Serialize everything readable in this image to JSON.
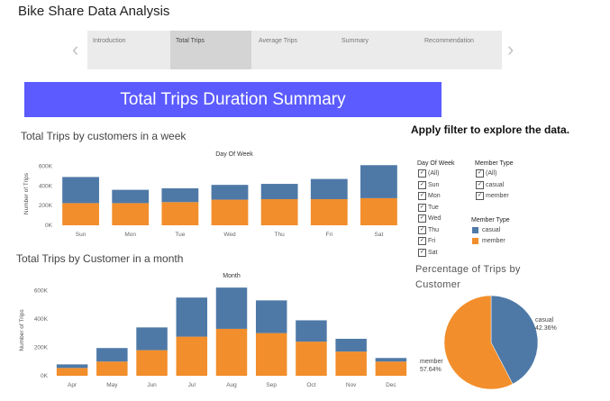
{
  "app": {
    "title": "Bike Share Data Analysis"
  },
  "nav": {
    "tabs": [
      {
        "label": "Introduction",
        "active": false
      },
      {
        "label": "Total Trips",
        "active": true
      },
      {
        "label": "Average Trips",
        "active": false
      },
      {
        "label": "Summary",
        "active": false
      },
      {
        "label": "Recommendation",
        "active": false
      }
    ],
    "prev_icon": "chevron-left-icon",
    "next_icon": "chevron-right-icon"
  },
  "banner": {
    "title": "Total Trips Duration Summary",
    "bg_color": "#5b5bff"
  },
  "colors": {
    "casual": "#4e79a7",
    "member": "#f28e2b"
  },
  "filters": {
    "heading": "Apply filter to explore the data.",
    "day_of_week": {
      "label": "Day Of Week",
      "options": [
        {
          "label": "(All)",
          "checked": true
        },
        {
          "label": "Sun",
          "checked": true
        },
        {
          "label": "Mon",
          "checked": true
        },
        {
          "label": "Tue",
          "checked": true
        },
        {
          "label": "Wed",
          "checked": true
        },
        {
          "label": "Thu",
          "checked": true
        },
        {
          "label": "Fri",
          "checked": true
        },
        {
          "label": "Sat",
          "checked": true
        }
      ]
    },
    "member_type": {
      "label": "Member Type",
      "options": [
        {
          "label": "(All)",
          "checked": true
        },
        {
          "label": "casual",
          "checked": true
        },
        {
          "label": "member",
          "checked": true
        }
      ]
    },
    "legend": {
      "label": "Member Type",
      "items": [
        {
          "label": "casual",
          "color": "#4e79a7"
        },
        {
          "label": "member",
          "color": "#f28e2b"
        }
      ]
    }
  },
  "pie": {
    "title": "Percentage of Trips by Customer",
    "casual_label": "casual",
    "casual_pct": "42.36%",
    "member_label": "member",
    "member_pct": "57.64%"
  },
  "chart_data": [
    {
      "type": "bar",
      "stacked": true,
      "title": "Total Trips by customers in a week",
      "header": "Day Of Week",
      "xlabel": "",
      "ylabel": "Number of Trips",
      "categories": [
        "Sun",
        "Mon",
        "Tue",
        "Wed",
        "Thu",
        "Fri",
        "Sat"
      ],
      "yticks": [
        0,
        200000,
        400000,
        600000
      ],
      "ytick_labels": [
        "0K",
        "200K",
        "400K",
        "600K"
      ],
      "ylim": [
        0,
        640000
      ],
      "series": [
        {
          "name": "member",
          "values": [
            225000,
            225000,
            235000,
            260000,
            265000,
            265000,
            275000
          ]
        },
        {
          "name": "casual",
          "values": [
            265000,
            135000,
            140000,
            150000,
            155000,
            205000,
            335000
          ]
        }
      ],
      "grid": false
    },
    {
      "type": "bar",
      "stacked": true,
      "title": "Total Trips by Customer in a month",
      "header": "Month",
      "xlabel": "",
      "ylabel": "Number of Trips",
      "categories": [
        "Apr",
        "May",
        "Jun",
        "Jul",
        "Aug",
        "Sep",
        "Oct",
        "Nov",
        "Dec"
      ],
      "yticks": [
        0,
        200000,
        400000,
        600000
      ],
      "ytick_labels": [
        "0K",
        "200K",
        "400K",
        "600K"
      ],
      "ylim": [
        0,
        640000
      ],
      "series": [
        {
          "name": "member",
          "values": [
            55000,
            100000,
            180000,
            275000,
            330000,
            300000,
            240000,
            170000,
            100000
          ]
        },
        {
          "name": "casual",
          "values": [
            25000,
            95000,
            160000,
            275000,
            290000,
            230000,
            150000,
            90000,
            25000
          ]
        }
      ],
      "grid": false
    },
    {
      "type": "pie",
      "title": "Percentage of Trips by Customer",
      "categories": [
        "casual",
        "member"
      ],
      "values": [
        42.36,
        57.64
      ]
    }
  ]
}
